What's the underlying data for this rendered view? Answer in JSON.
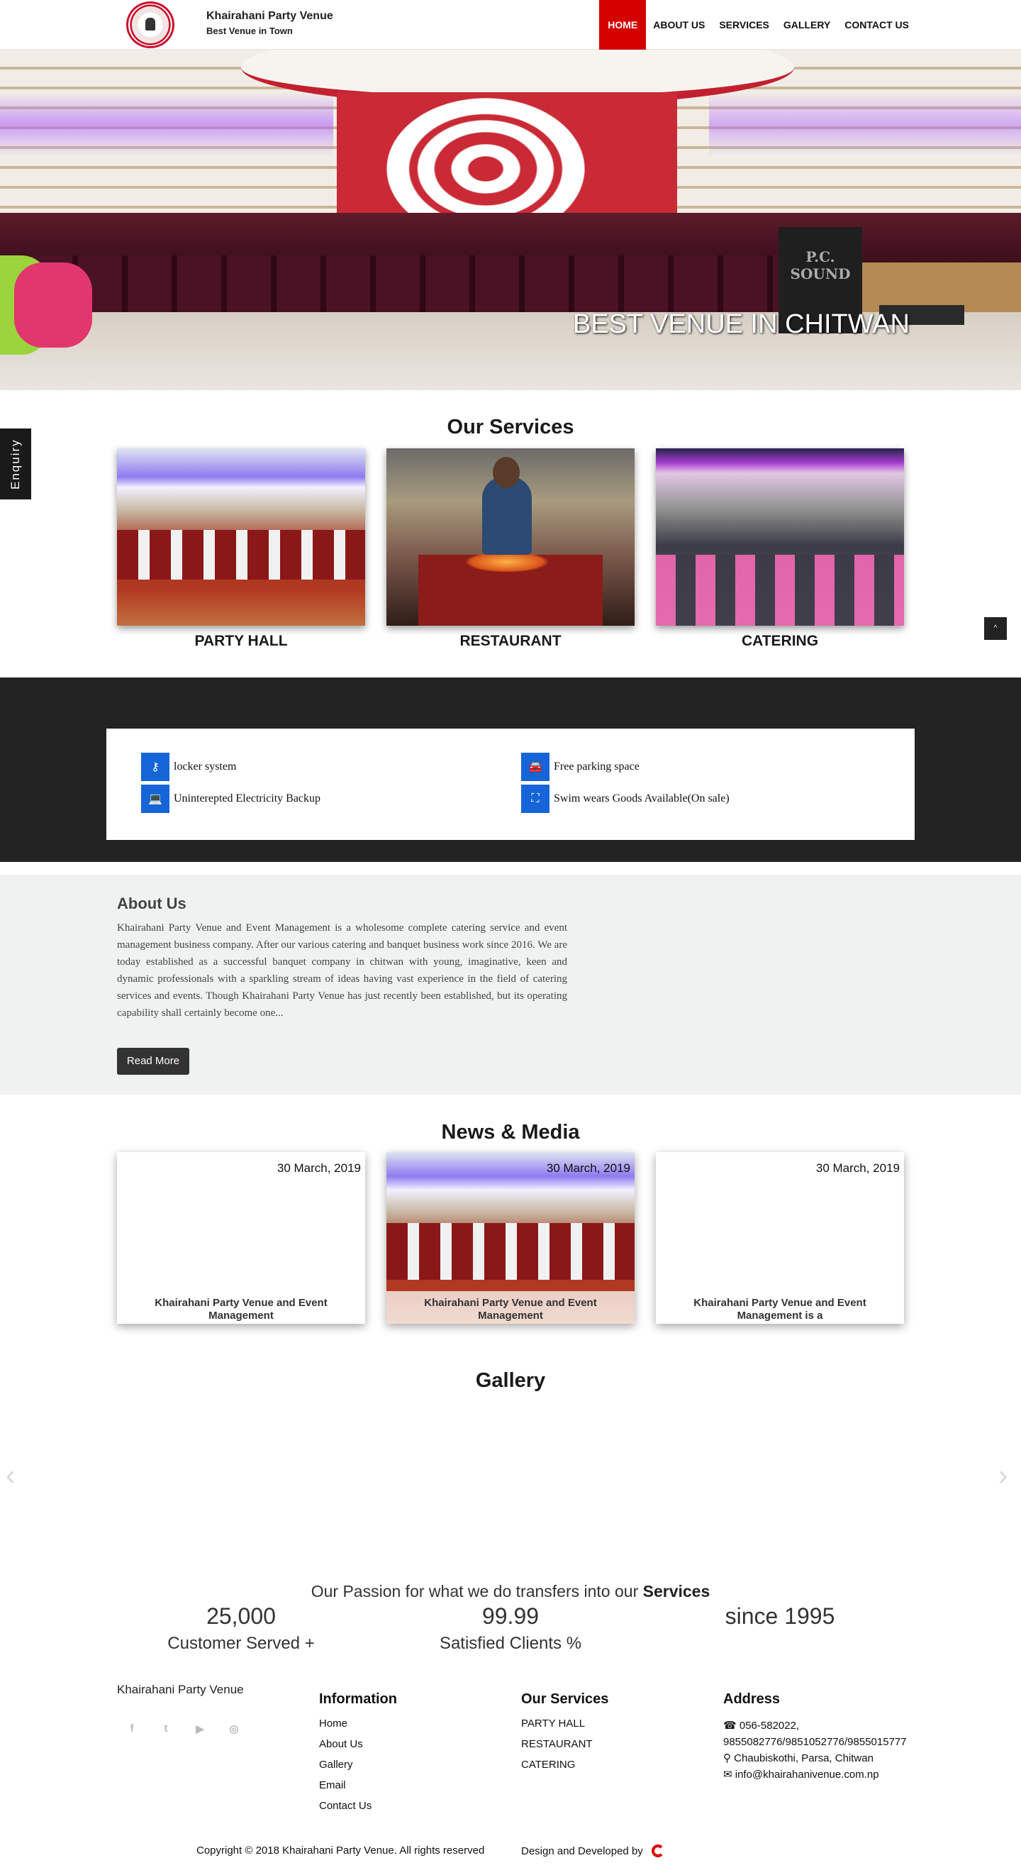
{
  "header": {
    "brand_title": "Khairahani Party Venue",
    "brand_tagline": "Best Venue in Town",
    "nav": [
      "HOME",
      "ABOUT US",
      "SERVICES",
      "GALLERY",
      "CONTACT US"
    ]
  },
  "hero": {
    "caption": "BEST VENUE IN CHITWAN",
    "speaker_text": "P.C. SOUND"
  },
  "enquiry": "Enquiry",
  "scroll_top": "^",
  "services": {
    "title": "Our Services",
    "items": [
      "PARTY HALL",
      "RESTAURANT",
      "CATERING"
    ]
  },
  "features": [
    {
      "icon": "key-icon",
      "label": "locker system"
    },
    {
      "icon": "car-icon",
      "label": "Free parking space"
    },
    {
      "icon": "laptop-icon",
      "label": "Uninterepted Electricity Backup"
    },
    {
      "icon": "binoculars-icon",
      "label": "Swim wears Goods Available(On sale)"
    }
  ],
  "about": {
    "title": "About Us",
    "text": "Khairahani Party Venue and Event Management is a wholesome complete catering service and event management business company. After our various catering and banquet business work since 2016. We are today established as a successful banquet company in chitwan with young, imaginative, keen and dynamic professionals with a sparkling stream of ideas having vast experience in the field of catering services and events. Though Khairahani Party Venue has just recently been established, but its operating capability shall certainly become one...",
    "button": "Read More"
  },
  "news": {
    "title": "News & Media",
    "items": [
      {
        "date": "30 March, 2019",
        "title": "Khairahani Party Venue and Event Management"
      },
      {
        "date": "30 March, 2019",
        "title": "Khairahani Party Venue and Event Management"
      },
      {
        "date": "30 March, 2019",
        "title": "Khairahani Party Venue and Event Management is a"
      }
    ]
  },
  "gallery": {
    "title": "Gallery",
    "prev": "‹",
    "next": "›"
  },
  "stats": {
    "passion_prefix": "Our Passion for what we do transfers into our",
    "passion_bold": "Services",
    "items": [
      {
        "number": "25,000",
        "label": "Customer Served +"
      },
      {
        "number": "99.99",
        "label": "Satisfied Clients %"
      },
      {
        "number": "since 1995",
        "label": ""
      }
    ]
  },
  "footer": {
    "brand": "Khairahani Party Venue",
    "social": [
      "f",
      "t",
      "▶",
      "◎"
    ],
    "information": {
      "title": "Information",
      "links": [
        "Home",
        "About Us",
        "Gallery",
        "Email",
        "Contact Us"
      ]
    },
    "our_services": {
      "title": "Our Services",
      "links": [
        "PARTY HALL",
        "RESTAURANT",
        "CATERING"
      ]
    },
    "address": {
      "title": "Address",
      "phone": "056-582022, 9855082776/9851052776/9855015777",
      "location": "Chaubiskothi, Parsa, Chitwan",
      "email": "info@khairahanivenue.com.np"
    },
    "copyright": "Copyright © 2018 Khairahani Party Venue. All rights reserved",
    "developed_by": "Design and Developed by"
  }
}
